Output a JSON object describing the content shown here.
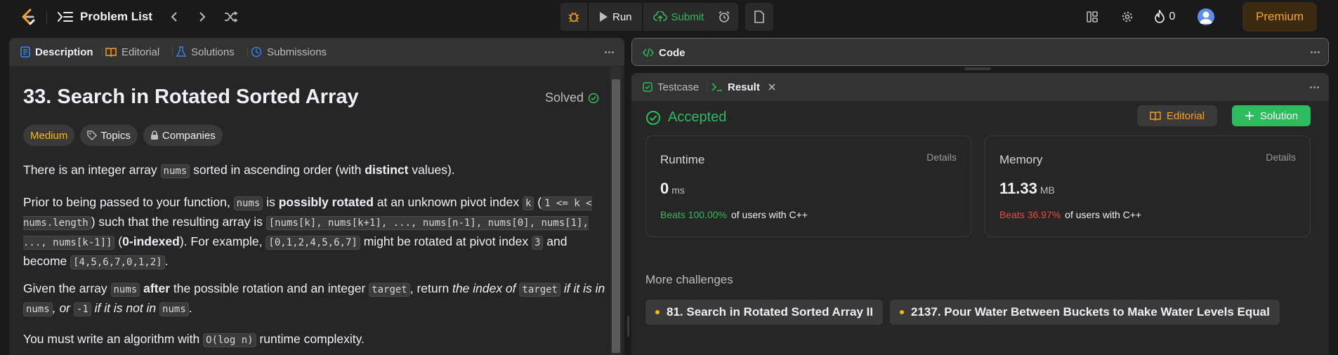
{
  "nav": {
    "problem_list": "Problem List",
    "run": "Run",
    "submit": "Submit",
    "streak": "0",
    "premium": "Premium"
  },
  "desc": {
    "tabs": [
      "Description",
      "Editorial",
      "Solutions",
      "Submissions"
    ],
    "title": "33. Search in Rotated Sorted Array",
    "solved": "Solved",
    "chips": [
      "Medium",
      "Topics",
      "Companies"
    ]
  },
  "code": {
    "tab": "Code"
  },
  "result": {
    "tabs": [
      "Testcase",
      "Result"
    ],
    "status": "Accepted",
    "editorial_btn": "Editorial",
    "solution_btn": "Solution",
    "runtime": {
      "label": "Runtime",
      "details": "Details",
      "value": "0",
      "unit": "ms",
      "beats": "Beats 100.00%",
      "suffix": "of users with C++"
    },
    "memory": {
      "label": "Memory",
      "details": "Details",
      "value": "11.33",
      "unit": "MB",
      "beats": "Beats 36.97%",
      "suffix": "of users with C++"
    },
    "more": "More challenges",
    "challenges": [
      "81. Search in Rotated Sorted Array II",
      "2137. Pour Water Between Buckets to Make Water Levels Equal"
    ]
  },
  "colors": {
    "accent": "#ffa116",
    "green": "#2cbb5d",
    "red": "#ef4743",
    "medium": "#ffb800"
  }
}
